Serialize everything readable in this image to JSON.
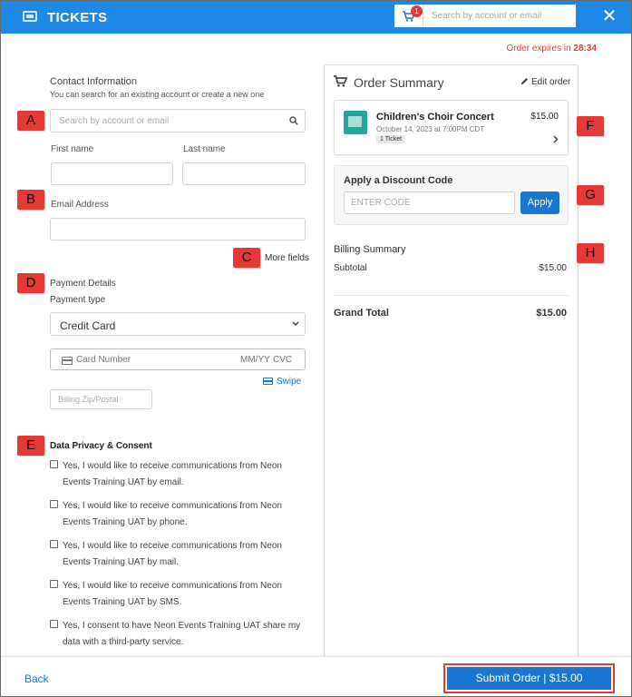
{
  "header": {
    "title": "TICKETS",
    "cart_count": "1",
    "search_placeholder": "Search by account or email",
    "close_glyph": "✕"
  },
  "expires": {
    "label": "Order expires in",
    "time": "28:34"
  },
  "callouts": {
    "a": "A",
    "b": "B",
    "c": "C",
    "d": "D",
    "e": "E",
    "f": "F",
    "g": "G",
    "h": "H"
  },
  "contact": {
    "title": "Contact Information",
    "subtitle": "You can search for an existing account or create a new one",
    "search_placeholder": "Search by account or email",
    "first_name_label": "First name",
    "last_name_label": "Last name",
    "email_label": "Email Address",
    "more_fields": "More fields"
  },
  "payment": {
    "title": "Payment Details",
    "type_label": "Payment type",
    "type_value": "Credit Card",
    "card_number_placeholder": "Card Number",
    "expiry_placeholder": "MM/YY",
    "cvc_placeholder": "CVC",
    "swipe": "Swipe",
    "zip_placeholder": "Billing Zip/Postal"
  },
  "consent": {
    "title": "Data Privacy & Consent",
    "items": [
      "Yes, I would like to receive communications from Neon Events Training UAT by email.",
      "Yes, I would like to receive communications from Neon Events Training UAT by phone.",
      "Yes, I would like to receive communications from Neon Events Training UAT by mail.",
      "Yes, I would like to receive communications from Neon Events Training UAT by SMS.",
      "Yes, I consent to have Neon Events Training UAT share my data with a third-party service."
    ]
  },
  "order_summary": {
    "title": "Order Summary",
    "edit": "Edit order",
    "event": {
      "name": "Children's Choir Concert",
      "date": "October 14, 2023 at 7:00PM CDT",
      "tickets": "1 Ticket",
      "price": "$15.00"
    },
    "discount": {
      "title": "Apply a Discount Code",
      "placeholder": "ENTER CODE",
      "button": "Apply"
    },
    "billing": {
      "title": "Billing Summary",
      "subtotal_label": "Subtotal",
      "subtotal_value": "$15.00",
      "grand_total_label": "Grand Total",
      "grand_total_value": "$15.00"
    }
  },
  "footer": {
    "back": "Back",
    "submit": "Submit Order  |  $15.00"
  },
  "colors": {
    "brand_blue": "#1e88e5",
    "button_blue": "#1976d2",
    "accent_red": "#e53935"
  }
}
